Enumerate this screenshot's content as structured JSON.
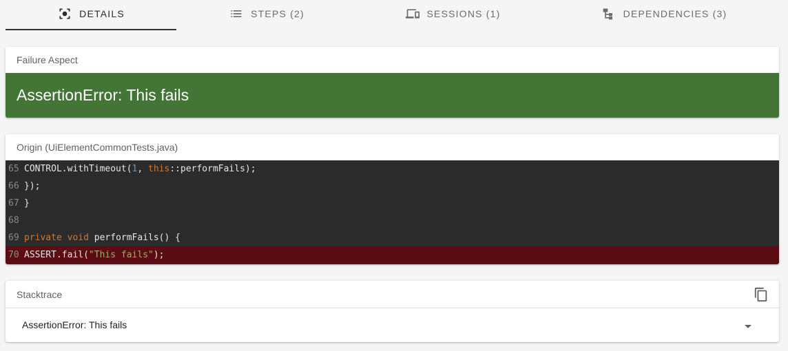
{
  "tabs": [
    {
      "label": "Details",
      "icon": "details-icon",
      "active": true
    },
    {
      "label": "Steps (2)",
      "icon": "list-icon",
      "active": false
    },
    {
      "label": "Sessions (1)",
      "icon": "devices-icon",
      "active": false
    },
    {
      "label": "Dependencies (3)",
      "icon": "hierarchy-icon",
      "active": false
    }
  ],
  "failure": {
    "header": "Failure Aspect",
    "message": "AssertionError: This fails",
    "color": "#437636"
  },
  "origin": {
    "header": "Origin (UiElementCommonTests.java)",
    "lines": [
      {
        "no": "65",
        "tokens": [
          [
            "plain",
            "CONTROL.withTimeout("
          ],
          [
            "num",
            "1"
          ],
          [
            "plain",
            ", "
          ],
          [
            "kw",
            "this"
          ],
          [
            "plain",
            "::performFails);"
          ]
        ]
      },
      {
        "no": "66",
        "tokens": [
          [
            "plain",
            "});"
          ]
        ]
      },
      {
        "no": "67",
        "tokens": [
          [
            "plain",
            "}"
          ]
        ]
      },
      {
        "no": "68",
        "tokens": [
          [
            "plain",
            ""
          ]
        ]
      },
      {
        "no": "69",
        "tokens": [
          [
            "kw",
            "private"
          ],
          [
            "plain",
            " "
          ],
          [
            "kw",
            "void"
          ],
          [
            "plain",
            " performFails() {"
          ]
        ]
      },
      {
        "no": "70",
        "error": true,
        "tokens": [
          [
            "plain",
            "ASSERT.fail("
          ],
          [
            "str",
            "\"This fails\""
          ],
          [
            "plain",
            ");"
          ]
        ]
      }
    ],
    "error_line_color": "#5c0c13"
  },
  "stacktrace": {
    "header": "Stacktrace",
    "copy_icon": "copy-icon",
    "summary": "AssertionError: This fails",
    "expand_icon": "chevron-down-icon"
  }
}
